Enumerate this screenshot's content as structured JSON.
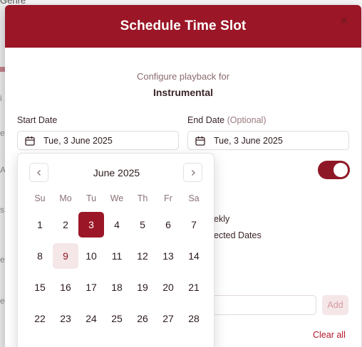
{
  "background": {
    "top_text": "Genre",
    "fragments": [
      "i",
      "e",
      "A",
      "s",
      "e",
      "e"
    ]
  },
  "modal": {
    "title": "Schedule Time Slot",
    "subtitle": "Configure playback for",
    "item_name": "Instrumental",
    "close_icon": "×"
  },
  "start_date": {
    "label": "Start Date",
    "value": "Tue, 3 June 2025"
  },
  "end_date": {
    "label": "End Date",
    "optional": "(Optional)",
    "value": "Tue, 3 June 2025"
  },
  "toggle": {
    "on": true
  },
  "options": {
    "weekly_fragment": "ekly",
    "selected_dates_fragment": "ected Dates"
  },
  "add_button": "Add",
  "clear_all": "Clear all",
  "calendar": {
    "month_label": "June 2025",
    "prev_icon": "chevron-left-icon",
    "next_icon": "chevron-right-icon",
    "weekdays": [
      "Su",
      "Mo",
      "Tu",
      "We",
      "Th",
      "Fr",
      "Sa"
    ],
    "weeks": [
      [
        "1",
        "2",
        "3",
        "4",
        "5",
        "6",
        "7"
      ],
      [
        "8",
        "9",
        "10",
        "11",
        "12",
        "13",
        "14"
      ],
      [
        "15",
        "16",
        "17",
        "18",
        "19",
        "20",
        "21"
      ],
      [
        "22",
        "23",
        "24",
        "25",
        "26",
        "27",
        "28"
      ]
    ],
    "selected_day": "3",
    "highlighted_day": "9"
  },
  "colors": {
    "accent": "#9b1627",
    "accent_soft": "#f5e6e8",
    "link": "#b3162b"
  }
}
